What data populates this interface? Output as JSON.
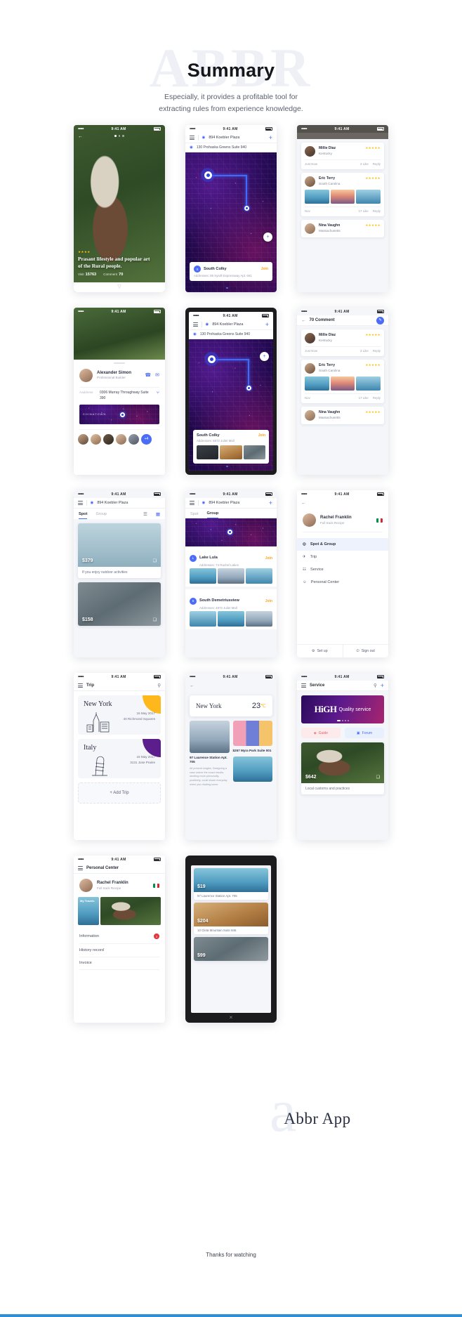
{
  "header": {
    "watermark": "ABBR",
    "title": "Summary",
    "subtitle_line1": "Especially, it provides a profitable tool for",
    "subtitle_line2": "extracting rules from experience knowledge."
  },
  "common": {
    "status_time": "9:41 AM",
    "signal_dots": "•••••",
    "nav_place": "894 Koebler Plaza",
    "address_full": "130 Prohaska Greens Suite 940",
    "stars_full": "★★★★★",
    "plus": "+",
    "back": "←",
    "pin": "◉",
    "search": "⚲"
  },
  "screen1": {
    "name": "detail-photo",
    "stars": "★★★★",
    "headline_1": "Prasant lifestyle and popular art",
    "headline_2": "of the Rural people.",
    "stat1_label": "Visit",
    "stat1_value": "15763",
    "stat2_label": "Comment",
    "stat2_value": "70"
  },
  "screen2": {
    "name": "map-spot",
    "card_title": "South Colky",
    "card_address": "Addresses: 86 Syivill Expressway Apt. 661",
    "join_label": "Join"
  },
  "screen3": {
    "name": "comment-list",
    "reviews": [
      {
        "name": "Millie Diaz",
        "location": "Kentucky",
        "stars": "★★★★★",
        "time": "Just Now",
        "likes": "3 Like",
        "reply": "Reply",
        "has_photos": false
      },
      {
        "name": "Eric Terry",
        "location": "South Carolina",
        "stars": "★★★★★",
        "time": "Nov",
        "likes": "17 Like",
        "reply": "Reply",
        "has_photos": true
      },
      {
        "name": "Nina Vaughn",
        "location": "Massachusetts",
        "stars": "★★★★★",
        "time": "",
        "likes": "",
        "reply": "",
        "has_photos": false
      }
    ]
  },
  "screen4": {
    "name": "profile-contact",
    "person_name": "Alexander Simon",
    "person_role": "Professional Builder",
    "address_label": "Aaddress",
    "address_value": "0306 Murray Throughway Suite 390",
    "map_label": "CHINATOWN",
    "avatars_more": "+4",
    "call_icon": "☎",
    "mail_icon": "✉",
    "route_icon": "⑂"
  },
  "screen5": {
    "name": "map-spot-gallery",
    "card_title": "South Colky",
    "card_address": "Addresses: 6672 Juliet Mall",
    "join_label": "Join"
  },
  "screen6": {
    "name": "comment-count",
    "title": "70 Comment",
    "edit_icon": "✎",
    "reviews": [
      {
        "name": "Millie Diaz",
        "location": "Kentucky",
        "stars": "★★★★★",
        "time": "Just Now",
        "likes": "3 Like",
        "reply": "Reply"
      },
      {
        "name": "Eric Terry",
        "location": "South Carolina",
        "stars": "★★★★★",
        "time": "Nov",
        "likes": "17 Like",
        "reply": "Reply"
      },
      {
        "name": "Nina Vaughn",
        "location": "Massachusetts",
        "stars": "★★★★★",
        "time": "",
        "likes": "",
        "reply": ""
      }
    ]
  },
  "screen7": {
    "name": "spot-list",
    "tab_spot": "Spot",
    "tab_group": "Group",
    "price1": "$379",
    "caption1": "If you enjoy outdoor activities",
    "price2": "$158",
    "grid_icon": "▦",
    "list_icon": "☰",
    "bookmark": "❑"
  },
  "screen8": {
    "name": "group-list",
    "tab_spot": "Spot",
    "tab_group": "Group",
    "groups": [
      {
        "title": "Lake Lula",
        "address": "Addresses: 74 Rachel Lakes",
        "join": "Join"
      },
      {
        "title": "South Demetriusview",
        "address": "Addresses: 4972 Juliet Mall",
        "join": "Join"
      }
    ]
  },
  "screen9": {
    "name": "account-menu",
    "person_name": "Rachel Franklin",
    "person_role": "Full track Recipe",
    "items": [
      {
        "label": "Spot & Group",
        "icon": "◎",
        "active": true
      },
      {
        "label": "Trip",
        "icon": "✈",
        "active": false
      },
      {
        "label": "Service",
        "icon": "☷",
        "active": false
      },
      {
        "label": "Personal Center",
        "icon": "☺",
        "active": false
      }
    ],
    "setup_label": "Set up",
    "signout_label": "Sign out",
    "setup_icon": "⚙",
    "signout_icon": "⏻"
  },
  "screen10": {
    "name": "trip-list",
    "title": "Trip",
    "trips": [
      {
        "place": "New York",
        "date": "16 May 2017",
        "address": "40 Richmond Squares",
        "color": "#ffb81c"
      },
      {
        "place": "Italy",
        "date": "16 May 2017",
        "address": "3131 Jose Prairie",
        "color": "#5c1e8c"
      }
    ],
    "add_label": "+  Add Trip"
  },
  "screen11": {
    "name": "city-weather",
    "city": "New York",
    "temperature": "23",
    "degree": "℃",
    "item_title": "97 Laurence Station Apt. 705",
    "item_body": "All present singles. Designing a case where the exact results, sending more personally, positively, could share everyday when you reading some.",
    "side_title": "$257 Myra Park Suite 001"
  },
  "screen12": {
    "name": "service-home",
    "title": "Service",
    "banner_high": "HiGH",
    "banner_quality": "Quality service",
    "chip1": "Guide",
    "chip2": "Forum",
    "chip1_icon": "◈",
    "chip2_icon": "▣",
    "price": "$642",
    "caption": "Local customs and practices"
  },
  "screen13": {
    "name": "personal-center",
    "title": "Personal Center",
    "person_name": "Rachel Franklin",
    "person_role": "Full track Recipe",
    "badge": "My Travels",
    "rows": [
      {
        "label": "Information",
        "badge": "3"
      },
      {
        "label": "History record",
        "badge": ""
      },
      {
        "label": "Invoice",
        "badge": ""
      }
    ]
  },
  "screen14": {
    "name": "device-preview",
    "cards": [
      {
        "price": "$19",
        "caption": "97 Laurence Station Apt. 705"
      },
      {
        "price": "$204",
        "caption": "10 Cleta Mountain Suite 846"
      },
      {
        "price": "$99",
        "caption": ""
      }
    ],
    "close_icon": "×"
  },
  "footer": {
    "logo_mark": "a",
    "logo_text": "Abbr App",
    "thanks": "Thanks for watching"
  },
  "colors": {
    "accent": "#4a6cf7",
    "orange": "#ff9f1c",
    "star": "#ffc107",
    "purple": "#5c1e8c",
    "bottom_bar": "#2f8fd6"
  }
}
